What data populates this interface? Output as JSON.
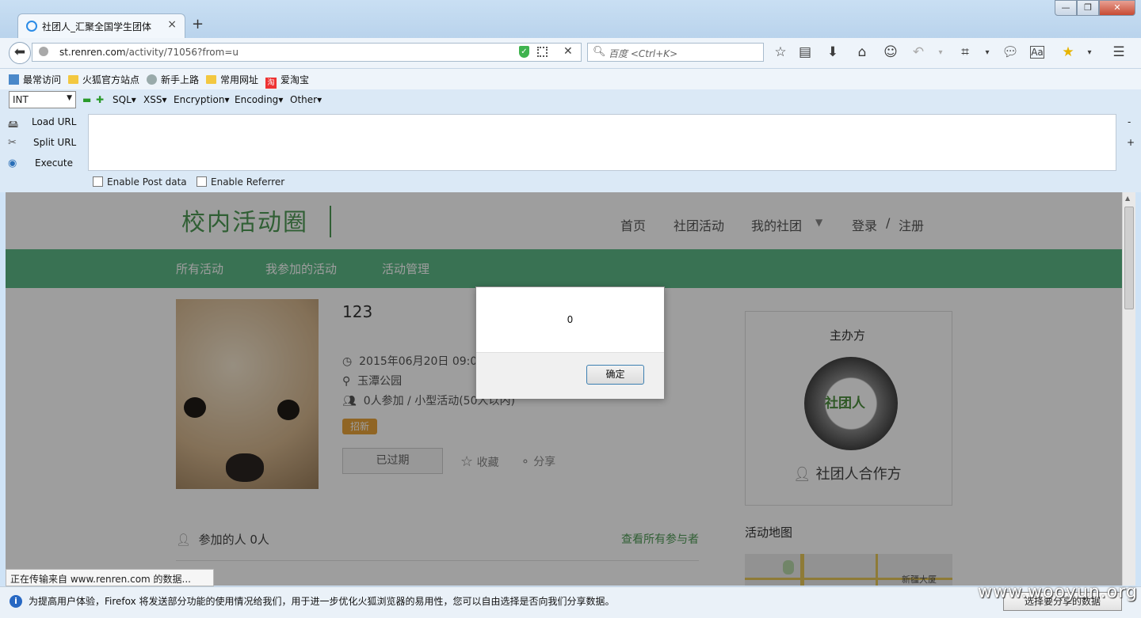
{
  "browser": {
    "tab_title": "社团人_汇聚全国学生团体",
    "tab_close": "×",
    "new_tab": "+",
    "window_min": "—",
    "window_max": "❐",
    "window_close": "✕",
    "url_host": "st.renren.com",
    "url_path": "/activity/71056?from=u",
    "search_placeholder": "百度 <Ctrl+K>"
  },
  "bookmarks": [
    "最常访问",
    "火狐官方站点",
    "新手上路",
    "常用网址",
    "爱淘宝"
  ],
  "hackbar": {
    "type_select": "INT",
    "menus": [
      "SQL",
      "XSS",
      "Encryption",
      "Encoding",
      "Other"
    ],
    "actions": [
      "Load URL",
      "Split URL",
      "Execute"
    ],
    "options": [
      "Enable Post data",
      "Enable Referrer"
    ],
    "side_minus": "-",
    "side_plus": "+"
  },
  "site": {
    "logo": "校内活动圈",
    "nav": [
      "首页",
      "社团活动",
      "我的社团",
      "登录",
      "/",
      "注册"
    ],
    "subnav": [
      "所有活动",
      "我参加的活动",
      "活动管理"
    ]
  },
  "activity": {
    "title": "123",
    "time": "2015年06月20日 09:00",
    "location": "玉潭公园",
    "participants": "0人参加 / 小型活动(50人以内)",
    "tag": "招新",
    "status_button": "已过期",
    "favorite": "收藏",
    "share": "分享",
    "joined_label": "参加的人 0人",
    "view_all": "查看所有参与者"
  },
  "organizer": {
    "heading": "主办方",
    "logo_text": "社团人",
    "name": "社团人合作方"
  },
  "map": {
    "heading": "活动地图",
    "label": "新疆大厦"
  },
  "dialog": {
    "message": "0",
    "ok": "确定"
  },
  "status_text": "正在传输来自 www.renren.com 的数据...",
  "notification": {
    "text": "为提高用户体验，Firefox 将发送部分功能的使用情况给我们，用于进一步优化火狐浏览器的易用性，您可以自由选择是否向我们分享数据。",
    "button": "选择要分享的数据"
  },
  "watermark": "www.wooyun.org"
}
